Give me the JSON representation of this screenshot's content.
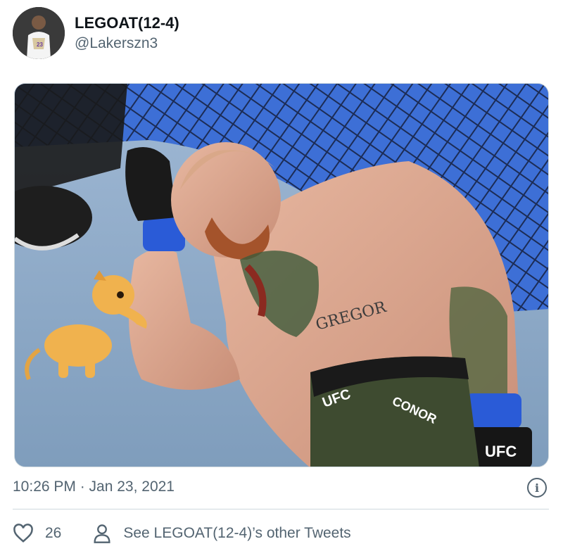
{
  "user": {
    "display_name": "LEGOAT(12-4)",
    "handle": "@Lakerszn3"
  },
  "media": {
    "avatar_icon": "avatar-photo",
    "photo_overlay_text": {
      "shorts_band": "UFC",
      "shorts_name": "CONOR",
      "chest_tattoo": "GREGOR",
      "glove_text": "UFC"
    }
  },
  "meta": {
    "timestamp": "10:26 PM · Jan 23, 2021",
    "info_icon": "i"
  },
  "actions": {
    "like_count": "26",
    "other_tweets_label": "See LEGOAT(12-4)’s other Tweets"
  },
  "colors": {
    "secondary_text": "#536471",
    "border": "#cfd9de",
    "primary_text": "#0f1419"
  }
}
